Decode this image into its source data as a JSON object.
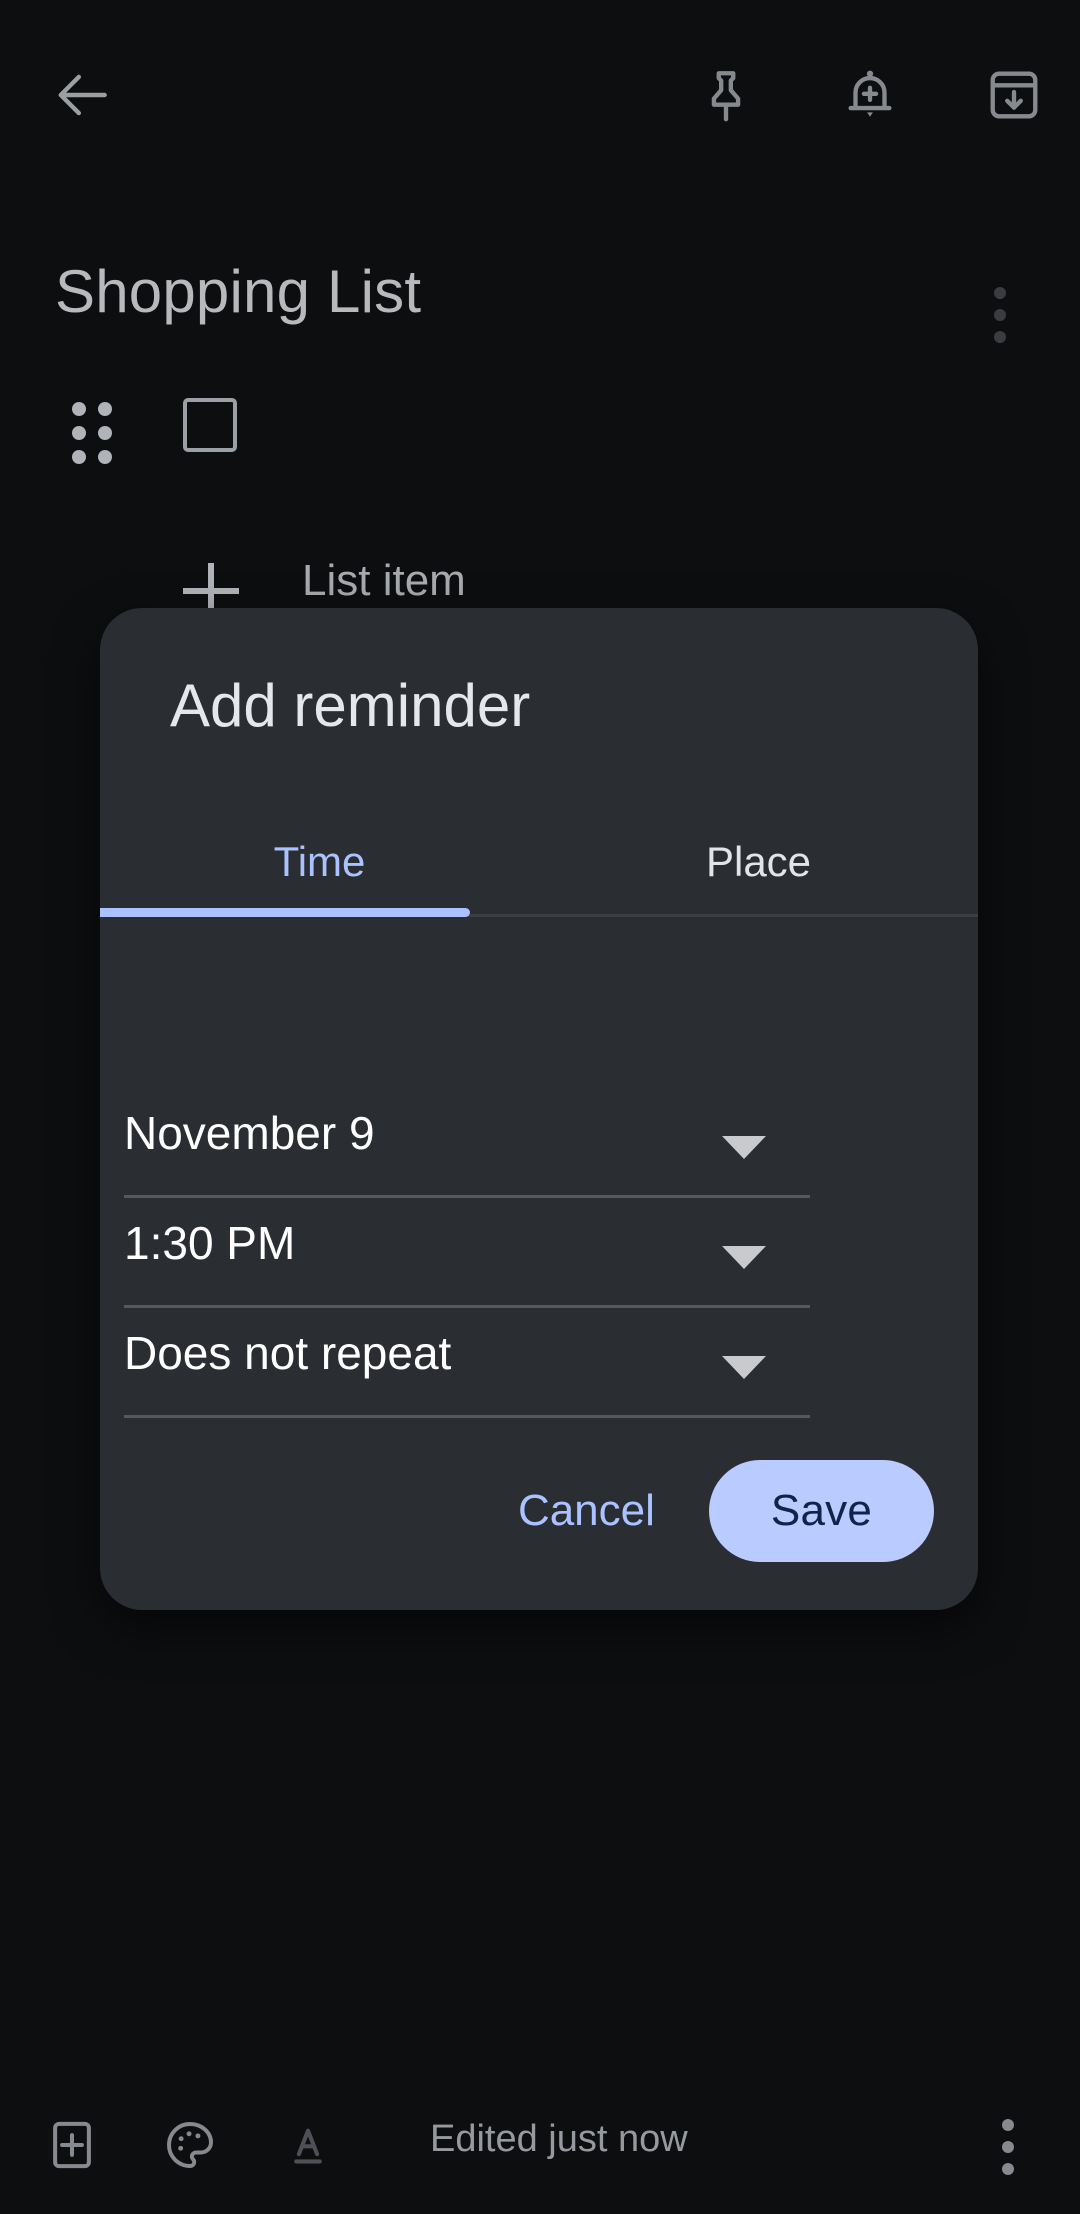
{
  "app": {
    "background_color": "#0d0e10",
    "surface_color": "#2a2d31",
    "accent_color": "#aac2ff"
  },
  "topbar": {
    "back_label": "Back",
    "pin_label": "Pin note",
    "reminder_label": "Add reminder",
    "archive_label": "Archive"
  },
  "note": {
    "title": "Shopping List",
    "overflow_label": "More options",
    "items": [
      {
        "text": "",
        "checked": false
      }
    ],
    "add_item_label": "List item"
  },
  "dialog": {
    "title": "Add reminder",
    "tabs": [
      {
        "label": "Time",
        "active": true
      },
      {
        "label": "Place",
        "active": false
      }
    ],
    "fields": [
      {
        "name": "date",
        "value": "November 9",
        "icon": "chevron-down-icon"
      },
      {
        "name": "time",
        "value": "1:30 PM",
        "icon": "chevron-down-icon"
      },
      {
        "name": "repeat",
        "value": "Does not repeat",
        "icon": "chevron-down-icon"
      }
    ],
    "cancel_label": "Cancel",
    "save_label": "Save"
  },
  "bottombar": {
    "add_label": "Add",
    "palette_label": "Change color",
    "format_label": "Formatting options",
    "status": "Edited just now",
    "more_label": "More options"
  }
}
